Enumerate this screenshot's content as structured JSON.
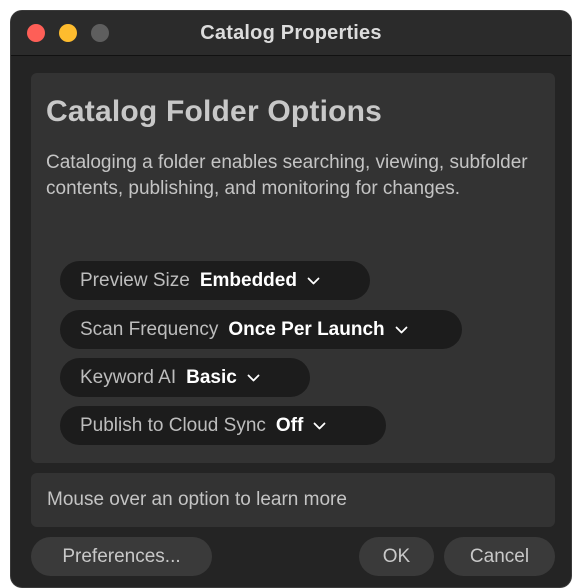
{
  "window": {
    "title": "Catalog Properties"
  },
  "panel": {
    "heading": "Catalog Folder Options",
    "description": "Cataloging a folder enables searching, viewing, subfolder contents, publishing, and monitoring for changes.",
    "options": [
      {
        "label": "Preview Size",
        "value": "Embedded"
      },
      {
        "label": "Scan Frequency",
        "value": "Once Per Launch"
      },
      {
        "label": "Keyword AI",
        "value": "Basic"
      },
      {
        "label": "Publish to Cloud Sync",
        "value": "Off"
      }
    ]
  },
  "info": {
    "text": "Mouse over an option to learn more"
  },
  "buttons": {
    "preferences": "Preferences...",
    "ok": "OK",
    "cancel": "Cancel"
  },
  "colors": {
    "close": "#fe5f57",
    "minimize": "#febc2e",
    "zoom_disabled": "#5e5e5e",
    "window_bg": "#242424",
    "panel_bg": "#333333",
    "pill_bg": "#1c1c1c"
  },
  "icons": {
    "dropdown": "chevron-down-icon"
  }
}
